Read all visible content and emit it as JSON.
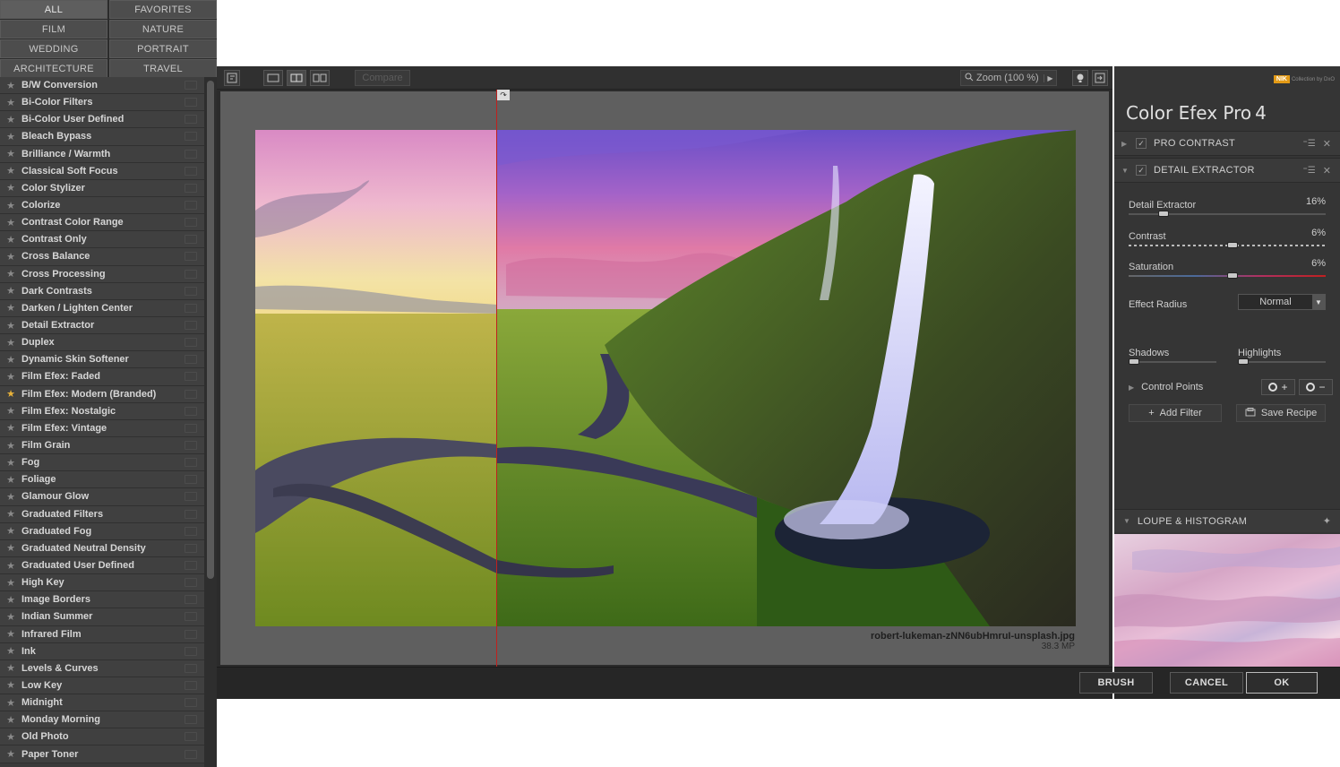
{
  "categories": [
    {
      "label": "ALL"
    },
    {
      "label": "FAVORITES"
    },
    {
      "label": "FILM"
    },
    {
      "label": "NATURE"
    },
    {
      "label": "WEDDING"
    },
    {
      "label": "PORTRAIT"
    },
    {
      "label": "ARCHITECTURE"
    },
    {
      "label": "TRAVEL"
    }
  ],
  "filters": [
    {
      "name": "B/W Conversion",
      "favorite": false
    },
    {
      "name": "Bi-Color Filters",
      "favorite": false
    },
    {
      "name": "Bi-Color User Defined",
      "favorite": false
    },
    {
      "name": "Bleach Bypass",
      "favorite": false
    },
    {
      "name": "Brilliance / Warmth",
      "favorite": false
    },
    {
      "name": "Classical Soft Focus",
      "favorite": false
    },
    {
      "name": "Color Stylizer",
      "favorite": false
    },
    {
      "name": "Colorize",
      "favorite": false
    },
    {
      "name": "Contrast Color Range",
      "favorite": false
    },
    {
      "name": "Contrast Only",
      "favorite": false
    },
    {
      "name": "Cross Balance",
      "favorite": false
    },
    {
      "name": "Cross Processing",
      "favorite": false
    },
    {
      "name": "Dark Contrasts",
      "favorite": false
    },
    {
      "name": "Darken / Lighten Center",
      "favorite": false
    },
    {
      "name": "Detail Extractor",
      "favorite": false
    },
    {
      "name": "Duplex",
      "favorite": false
    },
    {
      "name": "Dynamic Skin Softener",
      "favorite": false
    },
    {
      "name": "Film Efex: Faded",
      "favorite": false
    },
    {
      "name": "Film Efex: Modern (Branded)",
      "favorite": true
    },
    {
      "name": "Film Efex: Nostalgic",
      "favorite": false
    },
    {
      "name": "Film Efex: Vintage",
      "favorite": false
    },
    {
      "name": "Film Grain",
      "favorite": false
    },
    {
      "name": "Fog",
      "favorite": false
    },
    {
      "name": "Foliage",
      "favorite": false
    },
    {
      "name": "Glamour Glow",
      "favorite": false
    },
    {
      "name": "Graduated Filters",
      "favorite": false
    },
    {
      "name": "Graduated Fog",
      "favorite": false
    },
    {
      "name": "Graduated Neutral Density",
      "favorite": false
    },
    {
      "name": "Graduated User Defined",
      "favorite": false
    },
    {
      "name": "High Key",
      "favorite": false
    },
    {
      "name": "Image Borders",
      "favorite": false
    },
    {
      "name": "Indian Summer",
      "favorite": false
    },
    {
      "name": "Infrared Film",
      "favorite": false
    },
    {
      "name": "Ink",
      "favorite": false
    },
    {
      "name": "Levels & Curves",
      "favorite": false
    },
    {
      "name": "Low Key",
      "favorite": false
    },
    {
      "name": "Midnight",
      "favorite": false
    },
    {
      "name": "Monday Morning",
      "favorite": false
    },
    {
      "name": "Old Photo",
      "favorite": false
    },
    {
      "name": "Paper Toner",
      "favorite": false
    }
  ],
  "toolbar": {
    "compare_label": "Compare",
    "zoom_label": "Zoom (100 %)"
  },
  "image": {
    "filename": "robert-lukeman-zNN6ubHmruI-unsplash.jpg",
    "megapixels": "38.3 MP",
    "split_fraction": 0.295
  },
  "brand": {
    "logo_text": "NIK",
    "tagline": "Collection by DxO",
    "accent_color": "#e39a16"
  },
  "app": {
    "title": "Color Efex Pro",
    "version": "4"
  },
  "effects": [
    {
      "name": "PRO CONTRAST",
      "enabled": true,
      "expanded": false
    },
    {
      "name": "DETAIL EXTRACTOR",
      "enabled": true,
      "expanded": true
    }
  ],
  "detail_extractor": {
    "sliders": [
      {
        "label": "Detail Extractor",
        "value": "16%",
        "fraction": 0.16
      },
      {
        "label": "Contrast",
        "value": "6%",
        "fraction": 0.53
      },
      {
        "label": "Saturation",
        "value": "6%",
        "fraction": 0.53
      }
    ],
    "effect_radius_label": "Effect Radius",
    "effect_radius_value": "Normal",
    "shadows_label": "Shadows",
    "highlights_label": "Highlights",
    "control_points_label": "Control Points"
  },
  "actions": {
    "add_filter": "Add Filter",
    "save_recipe": "Save Recipe"
  },
  "loupe": {
    "title": "LOUPE & HISTOGRAM"
  },
  "footer": {
    "brush": "BRUSH",
    "cancel": "CANCEL",
    "ok": "OK"
  },
  "colors": {
    "split_line": "#c0201e",
    "favorite_star": "#e8b23a"
  }
}
